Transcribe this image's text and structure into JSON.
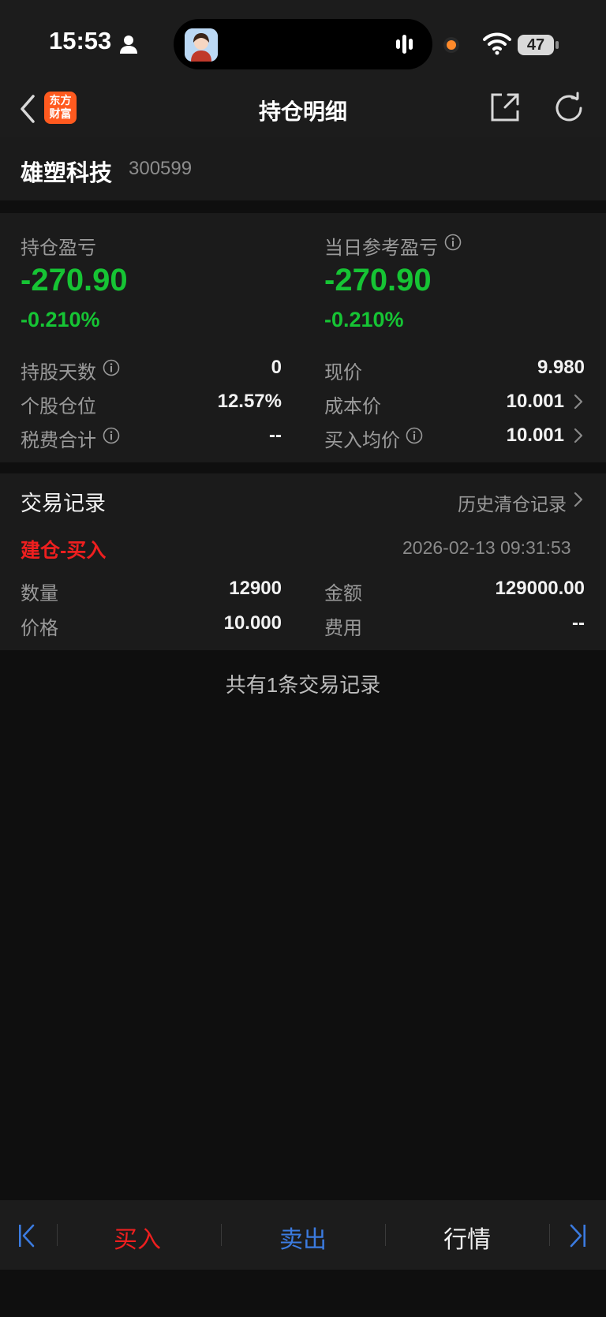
{
  "status_bar": {
    "time": "15:53",
    "battery": "47"
  },
  "header": {
    "logo_line1": "东方",
    "logo_line2": "财富",
    "title": "持仓明细"
  },
  "stock": {
    "name": "雄塑科技",
    "code": "300599"
  },
  "pnl": {
    "hold_label": "持仓盈亏",
    "hold_value": "-270.90",
    "hold_pct": "-0.210%",
    "today_label": "当日参考盈亏",
    "today_value": "-270.90",
    "today_pct": "-0.210%"
  },
  "details": {
    "days_label": "持股天数",
    "days_value": "0",
    "price_label": "现价",
    "price_value": "9.980",
    "position_label": "个股仓位",
    "position_value": "12.57%",
    "cost_label": "成本价",
    "cost_value": "10.001",
    "tax_label": "税费合计",
    "tax_value": "--",
    "avg_label": "买入均价",
    "avg_value": "10.001"
  },
  "trades": {
    "section_title": "交易记录",
    "history_link": "历史清仓记录",
    "record": {
      "type": "建仓-买入",
      "time": "2026-02-13 09:31:53",
      "qty_label": "数量",
      "qty_value": "12900",
      "amount_label": "金额",
      "amount_value": "129000.00",
      "price_label": "价格",
      "price_value": "10.000",
      "fee_label": "费用",
      "fee_value": "--"
    },
    "total_text": "共有1条交易记录"
  },
  "bottom": {
    "buy": "买入",
    "sell": "卖出",
    "quote": "行情"
  },
  "colors": {
    "profit_green": "#16c434",
    "buy_red": "#ee1f1f",
    "sell_blue": "#3b7be0",
    "accent_orange": "#ff5a1f"
  }
}
